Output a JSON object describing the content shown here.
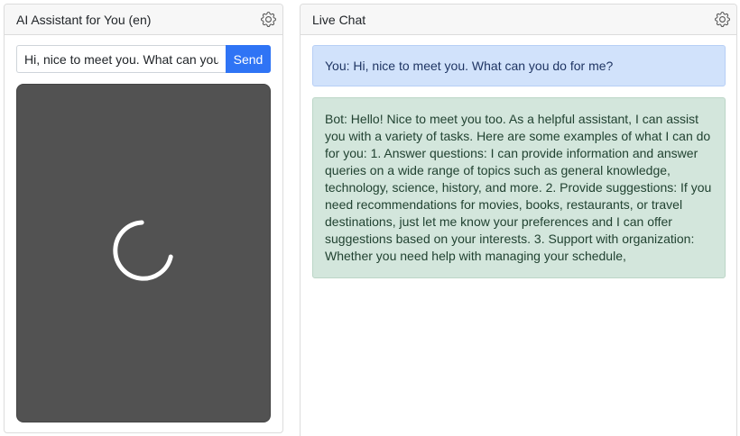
{
  "left_panel": {
    "title": "AI Assistant for You (en)",
    "input_value": "Hi, nice to meet you. What can you do for me?",
    "send_label": "Send",
    "status": "loading"
  },
  "right_panel": {
    "title": "Live Chat",
    "messages": [
      {
        "role": "user",
        "text": "You: Hi, nice to meet you. What can you do for me?"
      },
      {
        "role": "bot",
        "text": "Bot: Hello! Nice to meet you too. As a helpful assistant, I can assist you with a variety of tasks. Here are some examples of what I can do for you: 1. Answer questions: I can provide information and answer queries on a wide range of topics such as general knowledge, technology, science, history, and more. 2. Provide suggestions: If you need recommendations for movies, books, restaurants, or travel destinations, just let me know your preferences and I can offer suggestions based on your interests. 3. Support with organization: Whether you need help with managing your schedule,"
      }
    ]
  },
  "colors": {
    "send_button": "#2f74f5",
    "video_bg": "#525252",
    "user_bubble": "#d1e2fb",
    "bot_bubble": "#d3e6dc"
  }
}
